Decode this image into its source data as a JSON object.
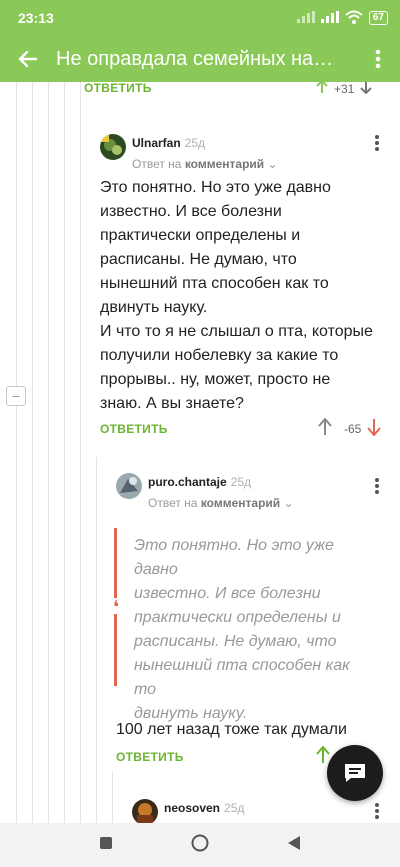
{
  "status_bar": {
    "time": "23:13",
    "battery": "67"
  },
  "app_bar": {
    "title": "Не оправдала семейных надежд"
  },
  "top_fragment": {
    "reply_label": "ОТВЕТИТЬ",
    "rating": "+31"
  },
  "comments": [
    {
      "username": "Ulnarfan",
      "age": "25д",
      "reply_prefix": "Ответ на",
      "reply_target": "комментарий",
      "text_lines": [
        "Это понятно. Но это уже давно",
        "известно. И все болезни",
        "практически определены и",
        "расписаны. Не думаю, что",
        "нынешний пта способен как то",
        "двинуть науку.",
        "И что то я не слышал о пта, которые",
        "получили нобелевку за какие то",
        "прорывы.. ну, может, просто не",
        "знаю. А вы знаете?"
      ],
      "reply_label": "ОТВЕТИТЬ",
      "rating": "-65"
    },
    {
      "username": "puro.chantaje",
      "age": "25д",
      "reply_prefix": "Ответ на",
      "reply_target": "комментарий",
      "quote_lines": [
        "Это понятно. Но это уже давно",
        "известно. И все болезни",
        "практически определены и",
        "расписаны. Не думаю, что",
        "нынешний пта способен как то",
        "двинуть науку."
      ],
      "text": "100 лет назад тоже так думали",
      "reply_label": "ОТВЕТИТЬ"
    },
    {
      "username": "neosoven",
      "age": "25д"
    }
  ],
  "colors": {
    "accent": "#8ac858",
    "reply_green": "#6ab42e",
    "downvote_red": "#e06855",
    "fab": "#1c1c1c"
  },
  "icons": [
    "back-arrow-icon",
    "more-vert-icon",
    "upvote-arrow-icon",
    "downvote-arrow-icon",
    "chevron-down-icon",
    "collapse-minus-icon",
    "quote-icon",
    "comments-icon",
    "nav-square-icon",
    "nav-circle-icon",
    "nav-triangle-icon"
  ]
}
